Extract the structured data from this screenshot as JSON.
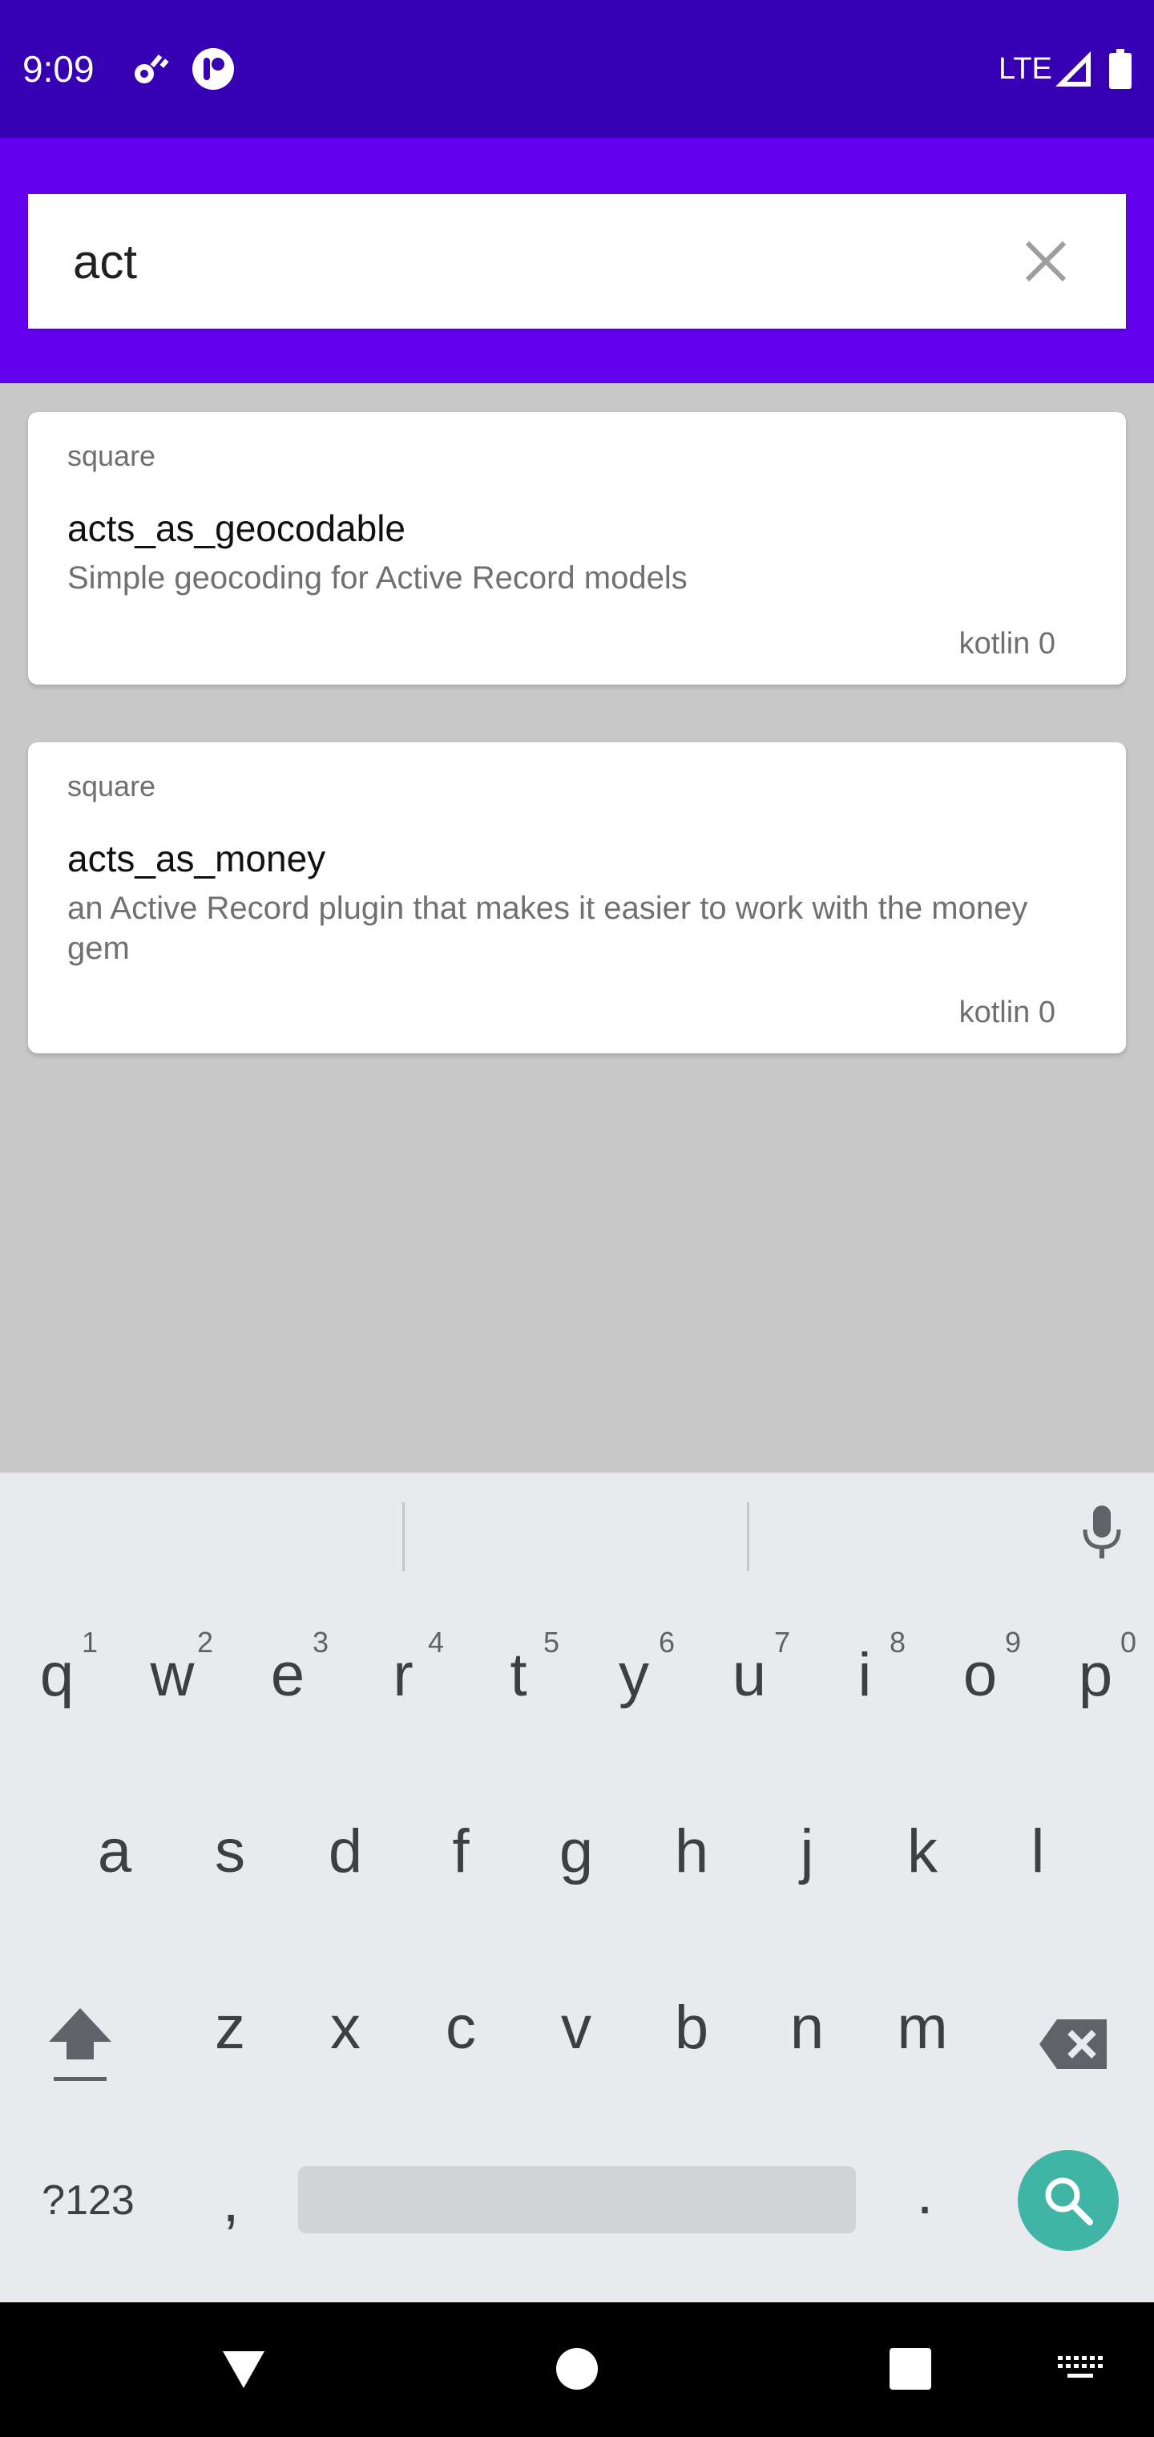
{
  "status_bar": {
    "time": "9:09",
    "network": "LTE",
    "icons": [
      "settings-sync-icon",
      "app-notification-icon",
      "signal-icon",
      "battery-icon"
    ]
  },
  "search": {
    "value": "act",
    "clear_icon": "close-icon"
  },
  "results": [
    {
      "owner": "square",
      "name": "acts_as_geocodable",
      "description": "Simple geocoding for Active Record models",
      "meta": "kotlin 0"
    },
    {
      "owner": "square",
      "name": "acts_as_money",
      "description": "an Active Record plugin that makes it easier to work with the money gem",
      "meta": "kotlin 0"
    }
  ],
  "keyboard": {
    "row1": [
      "q",
      "w",
      "e",
      "r",
      "t",
      "y",
      "u",
      "i",
      "o",
      "p"
    ],
    "row1_hints": [
      "1",
      "2",
      "3",
      "4",
      "5",
      "6",
      "7",
      "8",
      "9",
      "0"
    ],
    "row2": [
      "a",
      "s",
      "d",
      "f",
      "g",
      "h",
      "j",
      "k",
      "l"
    ],
    "row3": [
      "z",
      "x",
      "c",
      "v",
      "b",
      "n",
      "m"
    ],
    "symbols_label": "?123",
    "comma": ",",
    "period": ".",
    "icons": [
      "mic-icon",
      "shift-icon",
      "backspace-icon",
      "search-icon"
    ]
  },
  "nav_bar": {
    "icons": [
      "back-icon",
      "home-icon",
      "recents-icon",
      "keyboard-switch-icon"
    ]
  },
  "colors": {
    "status_bar": "#3700b3",
    "app_bar": "#6200ee",
    "background": "#c8c8c8",
    "fab": "#41b5a5"
  }
}
